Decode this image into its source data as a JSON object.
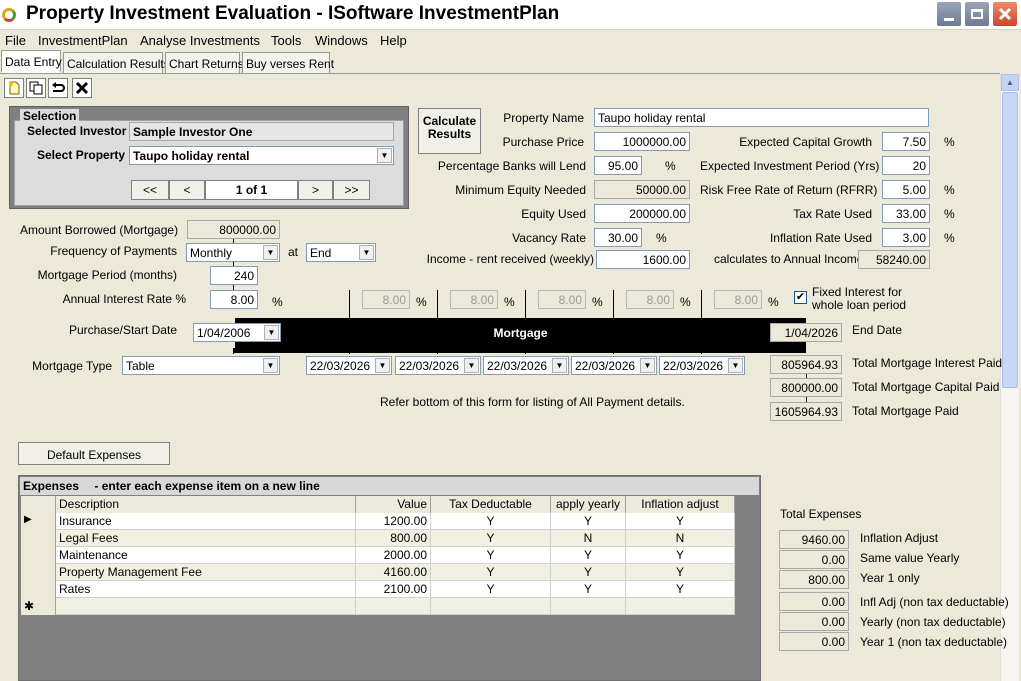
{
  "window": {
    "title": "Property Investment Evaluation - ISoftware InvestmentPlan",
    "controls": {
      "minimize_icon": "minimize-icon",
      "restore_icon": "restore-icon",
      "close_icon": "close-icon"
    }
  },
  "menu": [
    "File",
    "InvestmentPlan",
    "Analyse Investments",
    "Tools",
    "Windows",
    "Help"
  ],
  "tabs": [
    "Data Entry",
    "Calculation Results",
    "Chart Returns",
    "Buy verses Rent"
  ],
  "toolbar": {
    "icons": [
      "new-icon",
      "copy-icon",
      "undo-icon",
      "delete-icon"
    ]
  },
  "selection": {
    "title": "Selection",
    "investor_label": "Selected Investor",
    "investor_value": "Sample Investor One",
    "property_label": "Select Property",
    "property_value": "Taupo holiday rental",
    "nav": {
      "first": "<<",
      "prev": "<",
      "position": "1 of 1",
      "next": ">",
      "last": ">>"
    }
  },
  "calculate": {
    "line1": "Calculate",
    "line2": "Results"
  },
  "property": {
    "name_label": "Property Name",
    "name_value": "Taupo holiday rental",
    "price_label": "Purchase Price",
    "price_value": "1000000.00",
    "lend_label": "Percentage Banks will Lend",
    "lend_value": "95.00",
    "lend_unit": "%",
    "min_equity_label": "Minimum Equity Needed",
    "min_equity_value": "50000.00",
    "equity_label": "Equity Used",
    "equity_value": "200000.00",
    "vacancy_label": "Vacancy Rate",
    "vacancy_value": "30.00",
    "vacancy_unit": "%",
    "income_label": "Income - rent received (weekly)",
    "income_value": "1600.00",
    "growth_label": "Expected Capital Growth",
    "growth_value": "7.50",
    "growth_unit": "%",
    "period_label": "Expected Investment Period (Yrs)",
    "period_value": "20",
    "rfrr_label": "Risk Free Rate of Return (RFRR)",
    "rfrr_value": "5.00",
    "rfrr_unit": "%",
    "tax_label": "Tax Rate Used",
    "tax_value": "33.00",
    "tax_unit": "%",
    "inflation_label": "Inflation Rate Used",
    "inflation_value": "3.00",
    "inflation_unit": "%",
    "annual_income_label": "calculates to Annual Income",
    "annual_income_value": "58240.00"
  },
  "mortgage": {
    "borrowed_label": "Amount Borrowed (Mortgage)",
    "borrowed_value": "800000.00",
    "frequency_label": "Frequency of Payments",
    "frequency_value": "Monthly",
    "at_label": "at",
    "at_value": "End",
    "period_label": "Mortgage Period (months)",
    "period_value": "240",
    "rate_label": "Annual Interest Rate %",
    "rate_value": "8.00",
    "rate_unit": "%",
    "extra_rates": [
      "8.00",
      "8.00",
      "8.00",
      "8.00",
      "8.00"
    ],
    "fixed_label_1": "Fixed Interest for",
    "fixed_label_2": "whole loan period",
    "fixed_checked": "✔",
    "start_label": "Purchase/Start Date",
    "start_value": "1/04/2006",
    "bar_label": "Mortgage",
    "end_value": "1/04/2026",
    "end_label": "End Date",
    "type_label": "Mortgage Type",
    "type_value": "Table",
    "dates": [
      "22/03/2026",
      "22/03/2026",
      "22/03/2026",
      "22/03/2026",
      "22/03/2026"
    ],
    "interest_paid_value": "805964.93",
    "interest_paid_label": "Total Mortgage Interest Paid",
    "capital_paid_value": "800000.00",
    "capital_paid_label": "Total Mortgage Capital Paid",
    "total_paid_value": "1605964.93",
    "total_paid_label": "Total Mortgage Paid",
    "note": "Refer bottom of this form for listing of All Payment details."
  },
  "default_expenses_label": "Default Expenses",
  "expenses": {
    "title": "Expenses",
    "subtitle": "- enter each expense item on a new line",
    "columns": [
      "Description",
      "Value",
      "Tax Deductable",
      "apply yearly",
      "Inflation adjust"
    ],
    "rows": [
      {
        "description": "Insurance",
        "value": "1200.00",
        "tax": "Y",
        "yearly": "Y",
        "inflation": "Y"
      },
      {
        "description": "Legal Fees",
        "value": "800.00",
        "tax": "Y",
        "yearly": "N",
        "inflation": "N"
      },
      {
        "description": "Maintenance",
        "value": "2000.00",
        "tax": "Y",
        "yearly": "Y",
        "inflation": "Y"
      },
      {
        "description": "Property Management Fee",
        "value": "4160.00",
        "tax": "Y",
        "yearly": "Y",
        "inflation": "Y"
      },
      {
        "description": "Rates",
        "value": "2100.00",
        "tax": "Y",
        "yearly": "Y",
        "inflation": "Y"
      }
    ],
    "current_row_marker": "▶",
    "new_row_marker": "✱"
  },
  "totals": {
    "title": "Total Expenses",
    "items": [
      {
        "value": "9460.00",
        "label": "Inflation Adjust"
      },
      {
        "value": "0.00",
        "label": "Same value Yearly"
      },
      {
        "value": "800.00",
        "label": "Year 1 only"
      },
      {
        "value": "0.00",
        "label": "Infl Adj (non tax deductable)"
      },
      {
        "value": "0.00",
        "label": "Yearly (non tax deductable)"
      },
      {
        "value": "0.00",
        "label": "Year 1 (non tax deductable)"
      }
    ]
  }
}
